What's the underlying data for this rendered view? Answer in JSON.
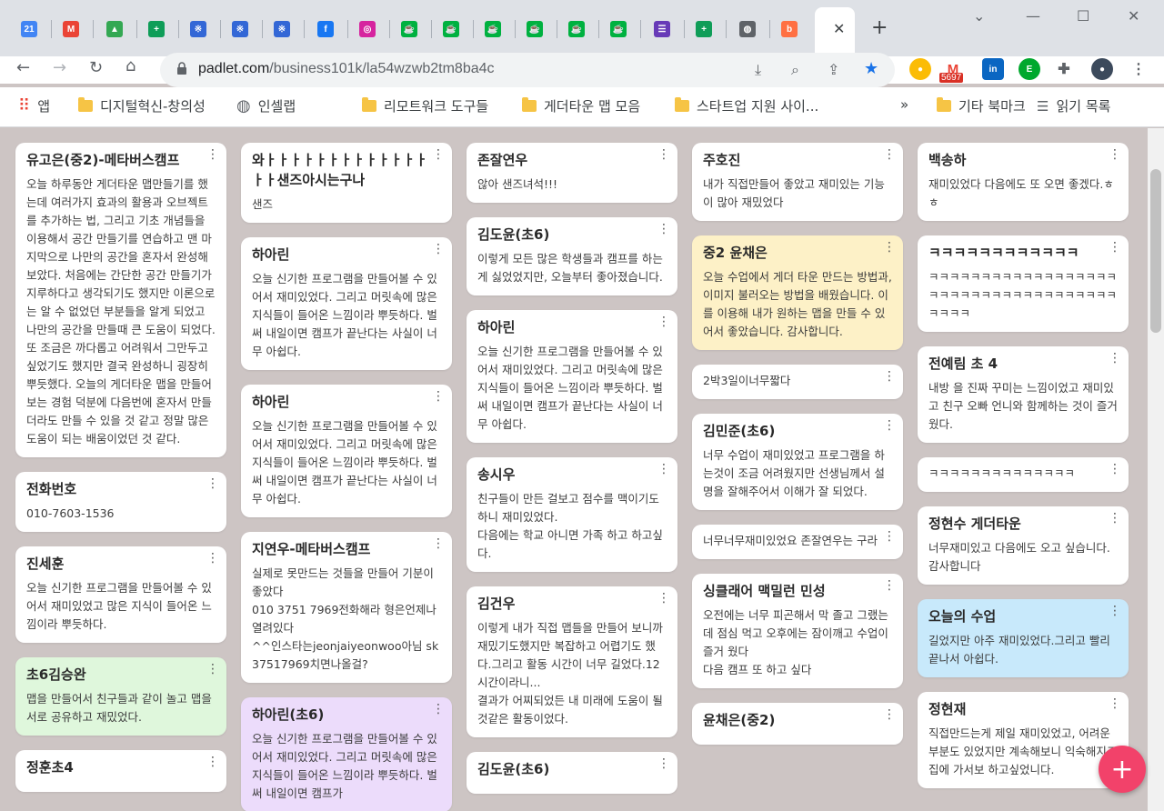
{
  "browser": {
    "tabs": [
      {
        "icon": "calendar-icon",
        "text": "21",
        "color": "#4285f4"
      },
      {
        "icon": "gmail-icon",
        "text": "M",
        "color": "#ea4335"
      },
      {
        "icon": "drive-icon",
        "text": "▲",
        "color": "#34a853"
      },
      {
        "icon": "sheets-icon",
        "text": "+",
        "color": "#0f9d58"
      },
      {
        "icon": "app-icon",
        "text": "※",
        "color": "#3367d6"
      },
      {
        "icon": "app-icon",
        "text": "※",
        "color": "#3367d6"
      },
      {
        "icon": "app-icon",
        "text": "※",
        "color": "#3367d6"
      },
      {
        "icon": "facebook-icon",
        "text": "f",
        "color": "#1877f2"
      },
      {
        "icon": "instagram-icon",
        "text": "◎",
        "color": "#d6249f"
      },
      {
        "icon": "cup-icon",
        "text": "☕",
        "color": "#00b140"
      },
      {
        "icon": "cup-icon",
        "text": "☕",
        "color": "#00b140"
      },
      {
        "icon": "cup-icon",
        "text": "☕",
        "color": "#00b140"
      },
      {
        "icon": "cup-icon",
        "text": "☕",
        "color": "#00b140"
      },
      {
        "icon": "cup-icon",
        "text": "☕",
        "color": "#00b140"
      },
      {
        "icon": "cup-icon",
        "text": "☕",
        "color": "#00b140"
      },
      {
        "icon": "list-icon",
        "text": "☰",
        "color": "#673ab7"
      },
      {
        "icon": "sheets-icon",
        "text": "+",
        "color": "#0f9d58"
      },
      {
        "icon": "globe-icon",
        "text": "◍",
        "color": "#5f6368"
      },
      {
        "icon": "b-icon",
        "text": "b",
        "color": "#ff7043"
      }
    ],
    "active_tab_close": "✕",
    "new_tab": "+",
    "url_host": "padlet.com",
    "url_path": "/business101k/la54wzwb2tm8ba4c",
    "gmail_badge": "5697"
  },
  "bookmarks": [
    {
      "label": "앱",
      "type": "apps"
    },
    {
      "label": "디지털혁신-창의성",
      "type": "folder"
    },
    {
      "label": "인셀랩",
      "type": "globe"
    },
    {
      "label": "리모트워크 도구들",
      "type": "folder"
    },
    {
      "label": "게더타운 맵 모음",
      "type": "folder"
    },
    {
      "label": "스타트업 지원 사이...",
      "type": "folder"
    },
    {
      "label": "»",
      "type": "more"
    },
    {
      "label": "기타 북마크",
      "type": "folder"
    },
    {
      "label": "읽기 목록",
      "type": "list"
    }
  ],
  "columns": [
    [
      {
        "title": "유고은(중2)-메타버스캠프",
        "body": "오늘 하루동안 게더타운 맵만들기를 했는데 여러가지 효과의 활용과 오브젝트를 추가하는 법, 그리고 기초 개념들을 이용해서 공간 만들기를 연습하고 맨 마지막으로 나만의 공간을 혼자서 완성해보았다. 처음에는 간단한 공간 만들기가 지루하다고 생각되기도 했지만 이론으로는 알 수 없었던 부분들을 알게 되었고 나만의 공간을 만들때 큰 도움이 되었다. 또 조금은 까다롭고 어려워서 그만두고 싶었기도 했지만 결국 완성하니 굉장히 뿌듯했다. 오늘의 게더타운 맵을 만들어보는 경험 덕분에 다음번에 혼자서 만들더라도 만들 수 있을 것 같고 정말 많은 도움이 되는 배움이었던 것 같다.",
        "bg": "#ffffff"
      },
      {
        "title": "전화번호",
        "body": "010-7603-1536",
        "bg": "#ffffff"
      },
      {
        "title": "진세훈",
        "body": "오늘 신기한 프로그램을 만들어볼 수 있어서 재미있었고 많은 지식이 들어온 느낌이라 뿌듯하다.",
        "bg": "#ffffff"
      },
      {
        "title": "초6김승완",
        "body": "맵을 만들어서 친구들과 같이 놀고 맵을 서로 공유하고 재밌었다.",
        "bg": "#dff7dc"
      },
      {
        "title": "정훈초4",
        "body": "",
        "bg": "#ffffff"
      }
    ],
    [
      {
        "title": "와ㅏㅏㅏㅏㅏㅏㅏㅏㅏㅏㅏㅏㅏㅏㅏ샌즈아시는구나",
        "body": "샌즈",
        "bg": "#ffffff"
      },
      {
        "title": "하아린",
        "body": "오늘 신기한 프로그램을 만들어볼 수 있어서 재미있었다. 그리고 머릿속에 많은 지식들이 들어온 느낌이라 뿌듯하다. 벌써 내일이면 캠프가 끝난다는 사실이 너무 아쉽다.",
        "bg": "#ffffff"
      },
      {
        "title": "하아린",
        "body": "오늘 신기한 프로그램을 만들어볼 수 있어서 재미있었다. 그리고 머릿속에 많은 지식들이 들어온 느낌이라 뿌듯하다. 벌써 내일이면 캠프가 끝난다는 사실이 너무 아쉽다.",
        "bg": "#ffffff"
      },
      {
        "title": "지연우-메타버스캠프",
        "body": "실제로 못만드는 것들을 만들어 기분이 좋았다\n010 3751 7969전화해라 형은언제나 열려있다\n^^인스타는jeonjaiyeonwoo아님 sk37517969치면나올걸?",
        "bg": "#ffffff"
      },
      {
        "title": "하아린(초6)",
        "body": "오늘 신기한 프로그램을 만들어볼 수 있어서 재미있었다. 그리고 머릿속에 많은 지식들이 들어온 느낌이라 뿌듯하다. 벌써 내일이면 캠프가",
        "bg": "#ecdcfb"
      }
    ],
    [
      {
        "title": "존잘연우",
        "body": "않아  샌즈녀석!!!",
        "bg": "#ffffff"
      },
      {
        "title": "김도윤(초6)",
        "body": "이렇게 모든 많은 학생들과 캠프를 하는게 싫었었지만, 오늘부터 좋아졌습니다.",
        "bg": "#ffffff"
      },
      {
        "title": "하아린",
        "body": "오늘 신기한 프로그램을 만들어볼 수 있어서 재미있었다. 그리고 머릿속에 많은 지식들이 들어온 느낌이라 뿌듯하다. 벌써 내일이면 캠프가 끝난다는 사실이 너무 아쉽다.",
        "bg": "#ffffff"
      },
      {
        "title": "송시우",
        "body": "친구들이 만든 걸보고 점수를 맥이기도 하니 재미있었다.\n다음에는 학교 아니면 가족 하고 하고싶다.",
        "bg": "#ffffff"
      },
      {
        "title": "김건우",
        "body": "이렇게 내가 직접 맵들을 만들어 보니까 재밌기도했지만 복잡하고 어렵기도 했다.그리고 활동 시간이 너무 길었다.12시간이라니...\n결과가 어찌되었든 내 미래에 도움이 될것같은 활동이었다.",
        "bg": "#ffffff"
      },
      {
        "title": "김도윤(초6)",
        "body": "",
        "bg": "#ffffff"
      }
    ],
    [
      {
        "title": "주호진",
        "body": "내가 직접만들어 좋았고 재미있는 기능이 많아 재밌었다",
        "bg": "#ffffff"
      },
      {
        "title": "중2 윤채은",
        "body": "오늘 수업에서 게더 타운 만드는 방법과, 이미지 불러오는 방법을 배웠습니다. 이를 이용해 내가 원하는 맵을 만들 수 있어서 좋았습니다. 감사합니다.",
        "bg": "#fdf1c7"
      },
      {
        "title": "",
        "body": "2박3일이너무짧다",
        "bg": "#ffffff"
      },
      {
        "title": "김민준(초6)",
        "body": "너무 수업이 재미있었고 프로그램을 하는것이 조금 어려웠지만 선생님께서 설명을 잘해주어서 이해가 잘 되었다.",
        "bg": "#ffffff"
      },
      {
        "title": "",
        "body": "너무너무재미있었요  존잘연우는 구라",
        "bg": "#ffffff"
      },
      {
        "title": "싱클래어 맥밀런 민성",
        "body": "오전에는 너무 피곤해서 막  졸고 그랬는데 점심 먹고 오후에는 잠이깨고 수업이 즐거 웠다\n다음 캠프 또 하고 싶다",
        "bg": "#ffffff"
      },
      {
        "title": "윤채은(중2)",
        "body": "",
        "bg": "#ffffff"
      }
    ],
    [
      {
        "title": "백송하",
        "body": "재미있었다 다음에도 또 오면 좋겠다.ㅎ\nㅎ",
        "bg": "#ffffff"
      },
      {
        "title": "ㅋㅋㅋㅋㅋㅋㅋㅋㅋㅋㅋㅋ",
        "body": "ㅋㅋㅋㅋㅋㅋㅋㅋㅋㅋㅋㅋㅋㅋㅋㅋㅋㅋㅋㅋㅋㅋㅋㅋㅋㅋㅋㅋㅋㅋㅋㅋㅋㅋㅋㅋㅋㅋㅋㅋ",
        "bg": "#ffffff"
      },
      {
        "title": "전예림 초 4",
        "body": "내방 을 진짜 꾸미는 느낌이었고 재미있고 친구 오빠 언니와 함께하는 것이 즐거웠다.",
        "bg": "#ffffff"
      },
      {
        "title": "",
        "body": "ㅋㅋㅋㅋㅋㅋㅋㅋㅋㅋㅋㅋㅋㅋ",
        "bg": "#ffffff"
      },
      {
        "title": "정현수 게더타운",
        "body": "너무재미있고  다음에도 오고 싶습니다.감사합니다",
        "bg": "#ffffff"
      },
      {
        "title": "오늘의 수업",
        "body": "길었지만 아주 재미있었다.그리고 빨리 끝나서 아쉽다.",
        "bg": "#c8e9fb"
      },
      {
        "title": "정현재",
        "body": "직접만드는게 제일 재미있었고, 어려운 부분도 있었지만 계속해보니 익숙해지고 집에 가서보 하고싶었니다.",
        "bg": "#ffffff"
      }
    ]
  ],
  "fab_label": "+"
}
